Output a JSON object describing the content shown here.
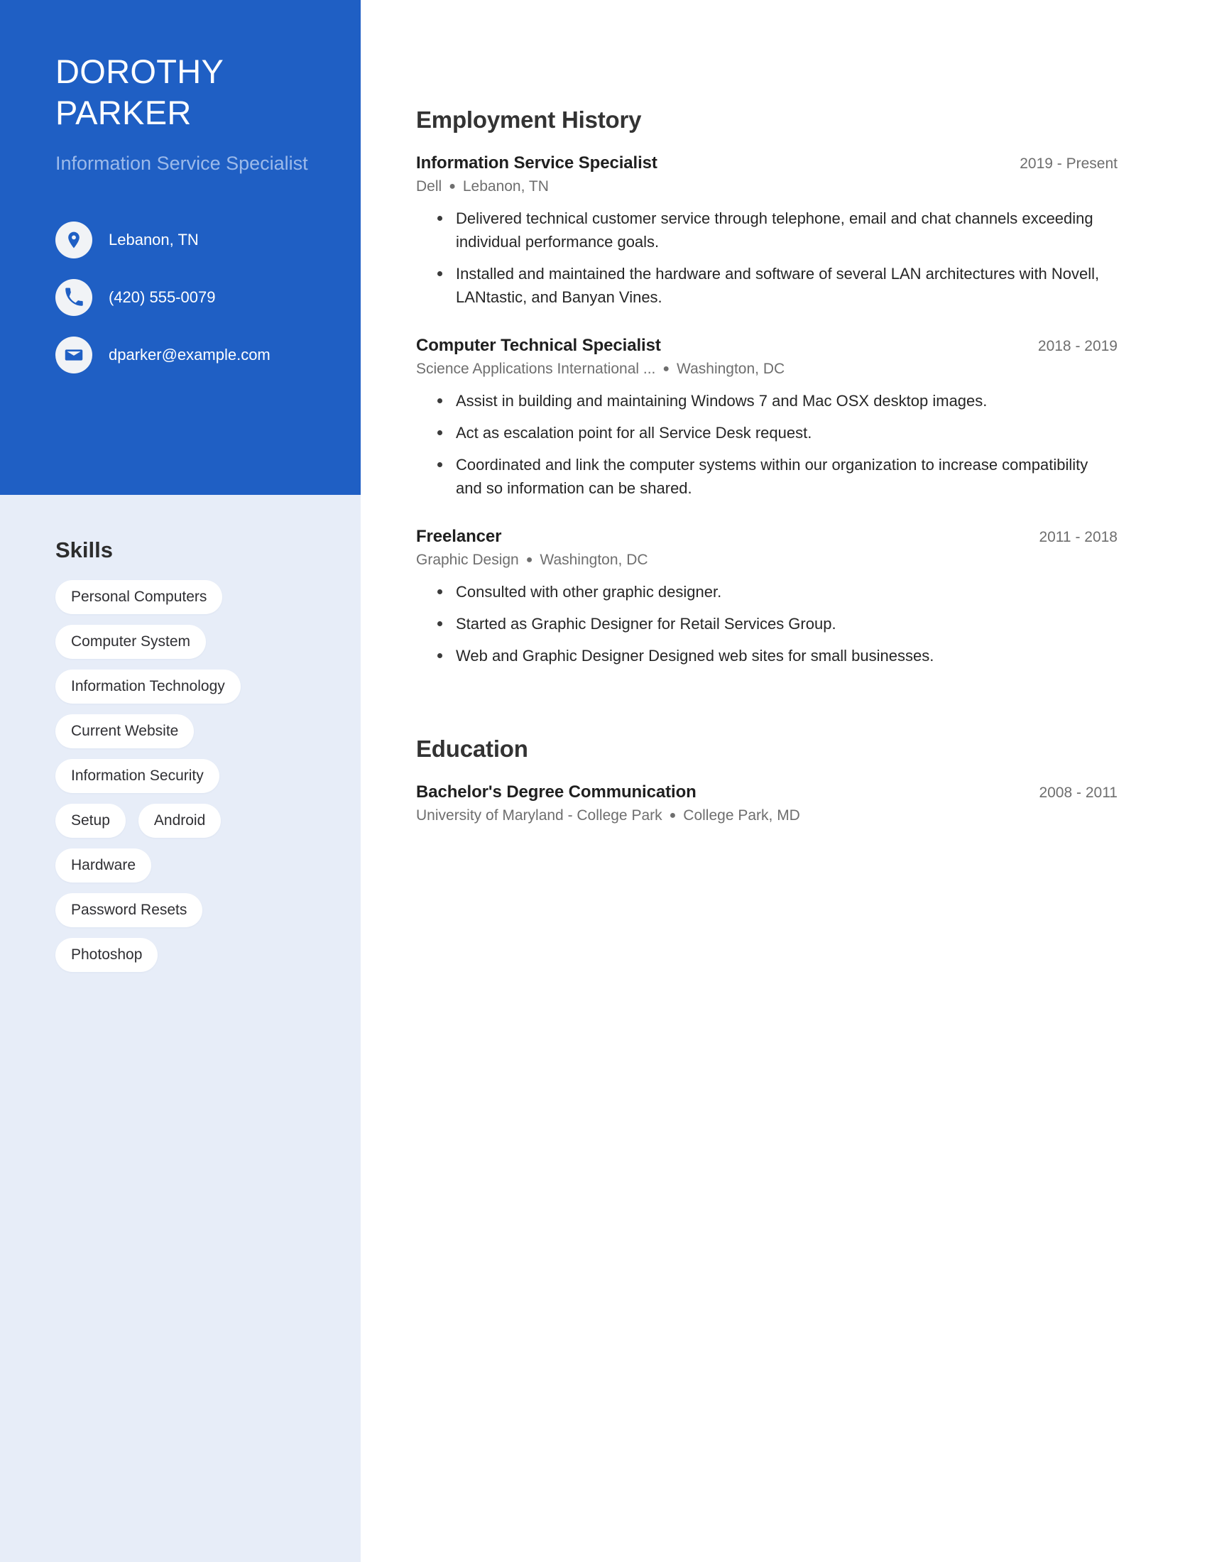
{
  "theme": {
    "primary_blue": "#1f5fc4",
    "sidebar_bg": "#e7edf8",
    "subtitle_color": "#9cbaea",
    "pill_bg": "#ffffff",
    "heading_color": "#333333",
    "muted_text": "#6e6e6e"
  },
  "sidebar": {
    "name_line1": "DOROTHY",
    "name_line2": "PARKER",
    "subtitle": "Information Service Specialist",
    "contacts": [
      {
        "icon": "location-pin-icon",
        "value": "Lebanon, TN"
      },
      {
        "icon": "phone-icon",
        "value": "(420) 555-0079"
      },
      {
        "icon": "envelope-icon",
        "value": "dparker@example.com"
      }
    ],
    "skills_title": "Skills",
    "skill_rows": [
      [
        "Personal Computers"
      ],
      [
        "Computer System"
      ],
      [
        "Information Technology"
      ],
      [
        "Current Website"
      ],
      [
        "Information Security"
      ],
      [
        "Setup",
        "Android"
      ],
      [
        "Hardware"
      ],
      [
        "Password Resets"
      ],
      [
        "Photoshop"
      ]
    ]
  },
  "main": {
    "employment": {
      "title": "Employment History",
      "entries": [
        {
          "role": "Information Service Specialist",
          "date": "2019 - Present",
          "company": "Dell",
          "separator": "●",
          "location": "Lebanon, TN",
          "bullets": [
            "Delivered technical customer service through telephone, email and chat channels exceeding individual performance goals.",
            "Installed and maintained the hardware and software of several LAN architectures with Novell, LANtastic, and Banyan Vines."
          ]
        },
        {
          "role": "Computer Technical Specialist",
          "date": "2018 - 2019",
          "company": "Science Applications International ...",
          "separator": "●",
          "location": "Washington, DC",
          "bullets": [
            "Assist in building and maintaining Windows 7 and Mac OSX desktop images.",
            "Act as escalation point for all Service Desk request.",
            "Coordinated and link the computer systems within our organization to increase compatibility and so information can be shared."
          ]
        },
        {
          "role": "Freelancer",
          "date": "2011 - 2018",
          "company": "Graphic Design",
          "separator": "●",
          "location": "Washington, DC",
          "bullets": [
            "Consulted with other graphic designer.",
            "Started as Graphic Designer for Retail Services Group.",
            "Web and Graphic Designer Designed web sites for small businesses."
          ]
        }
      ]
    },
    "education": {
      "title": "Education",
      "entries": [
        {
          "role": "Bachelor's Degree Communication",
          "date": "2008 - 2011",
          "company": "University of Maryland - College Park",
          "separator": "●",
          "location": "College Park, MD",
          "bullets": []
        }
      ]
    }
  }
}
